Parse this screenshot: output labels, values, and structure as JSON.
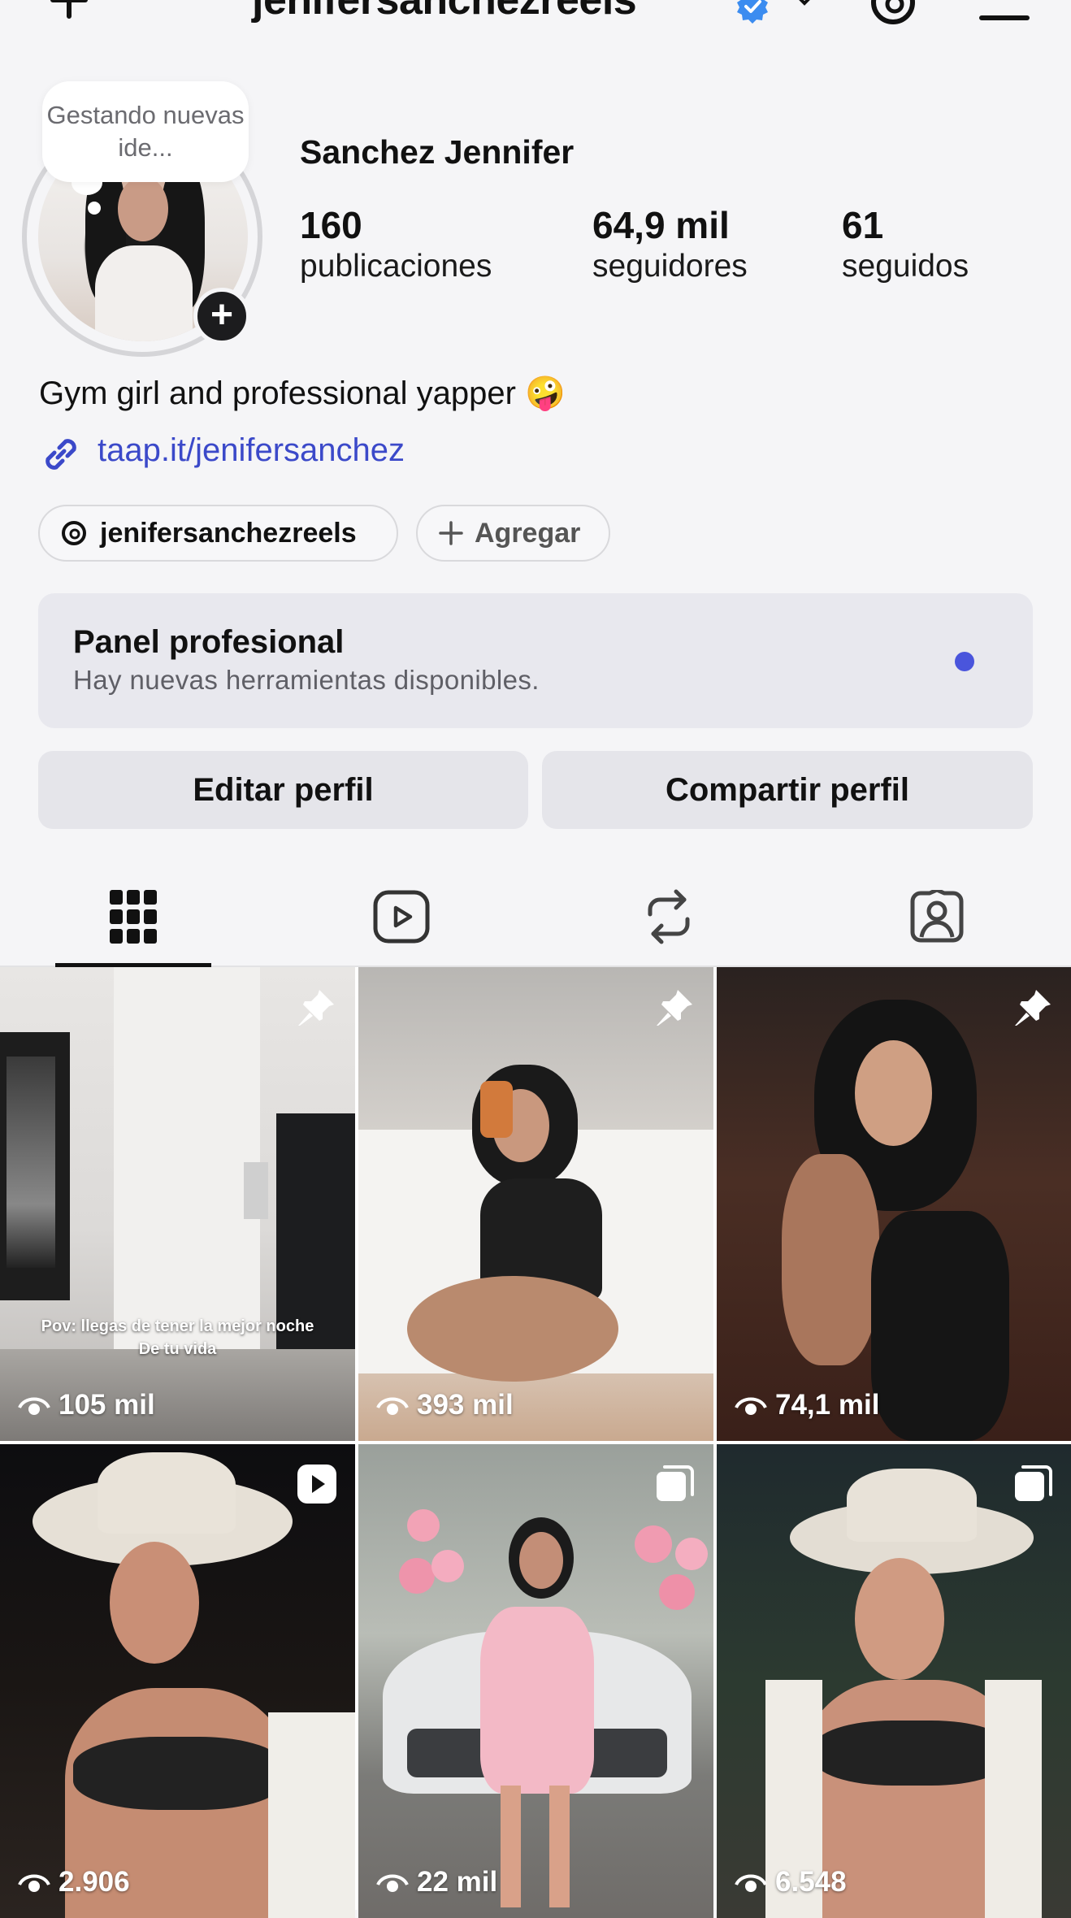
{
  "header": {
    "username": "jenifersanchezreels",
    "verified": true,
    "icons": [
      "new-post-icon",
      "verified-badge-icon",
      "chevron-down-icon",
      "threads-icon",
      "menu-icon"
    ]
  },
  "profile": {
    "note": "Gestando nuevas ide...",
    "display_name": "Sanchez Jennifer",
    "stats": [
      {
        "value": "160",
        "label": "publicaciones"
      },
      {
        "value": "64,9 mil",
        "label": "seguidores"
      },
      {
        "value": "61",
        "label": "seguidos"
      }
    ],
    "bio": "Gym girl and professional yapper 🤪",
    "link": "taap.it/jenifersanchez",
    "chips": {
      "threads": "jenifersanchezreels",
      "add": "Agregar"
    }
  },
  "panel": {
    "title": "Panel profesional",
    "subtitle": "Hay nuevas herramientas disponibles.",
    "dot_color": "#4a55dc"
  },
  "buttons": {
    "edit": "Editar perfil",
    "share": "Compartir perfil"
  },
  "tabs": [
    {
      "icon": "grid-icon",
      "active": true
    },
    {
      "icon": "reels-icon",
      "active": false
    },
    {
      "icon": "reposts-icon",
      "active": false
    },
    {
      "icon": "tagged-icon",
      "active": false
    }
  ],
  "posts": [
    {
      "views": "105 mil",
      "badge": "pin-icon",
      "caption_line1": "Pov: llegas de tener la mejor noche",
      "caption_line2": "De tu vida"
    },
    {
      "views": "393 mil",
      "badge": "pin-icon"
    },
    {
      "views": "74,1 mil",
      "badge": "pin-icon"
    },
    {
      "views": "2.906",
      "badge": "reel-icon"
    },
    {
      "views": "22 mil",
      "badge": "carousel-icon"
    },
    {
      "views": "6.548",
      "badge": "carousel-icon"
    }
  ]
}
